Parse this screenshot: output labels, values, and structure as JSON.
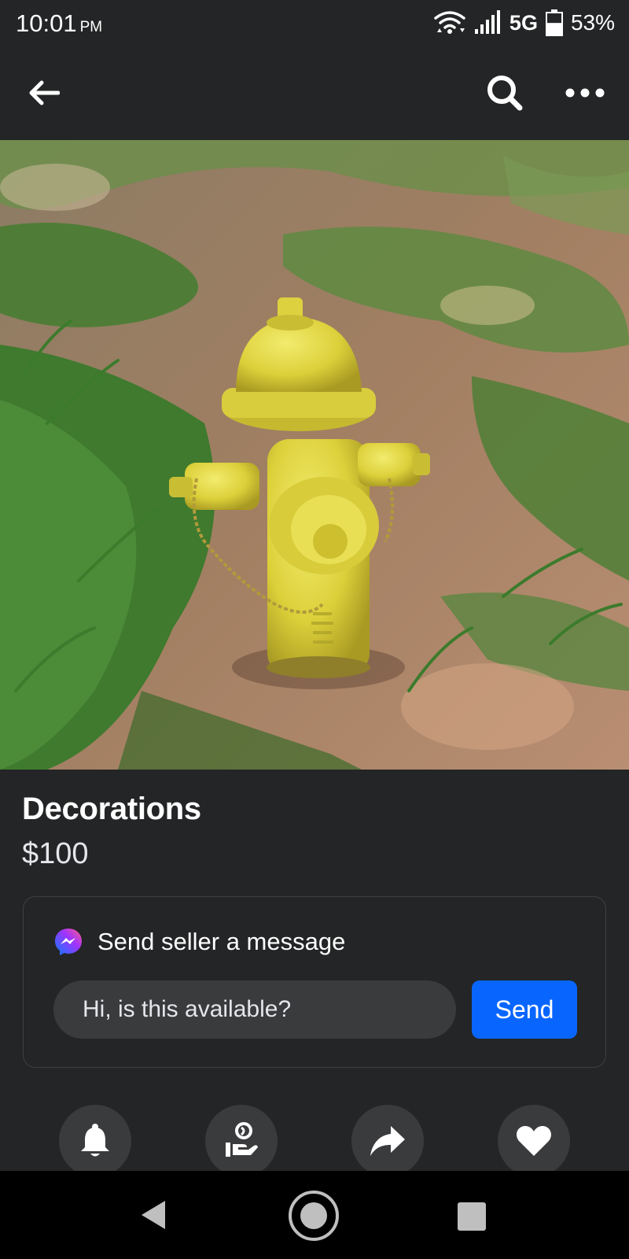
{
  "status_bar": {
    "time": "10:01",
    "ampm": "PM",
    "network": "5G",
    "battery": "53%",
    "battery_level": 0.53
  },
  "header": {
    "back_icon": "arrow-left-icon",
    "search_icon": "search-icon",
    "more_icon": "more-horizontal-icon"
  },
  "listing": {
    "photo_subject": "yellow-fire-hydrant-photo",
    "title": "Decorations",
    "price": "$100"
  },
  "message": {
    "header": "Send seller a message",
    "input_value": "Hi, is this available?",
    "send_label": "Send",
    "accent": "#0866ff"
  },
  "actions": [
    {
      "icon": "bell-icon"
    },
    {
      "icon": "person-hand-icon"
    },
    {
      "icon": "share-arrow-icon"
    },
    {
      "icon": "heart-icon"
    }
  ],
  "nav": {
    "back_icon": "nav-back-icon",
    "home_icon": "nav-home-icon",
    "recents_icon": "nav-recents-icon"
  }
}
